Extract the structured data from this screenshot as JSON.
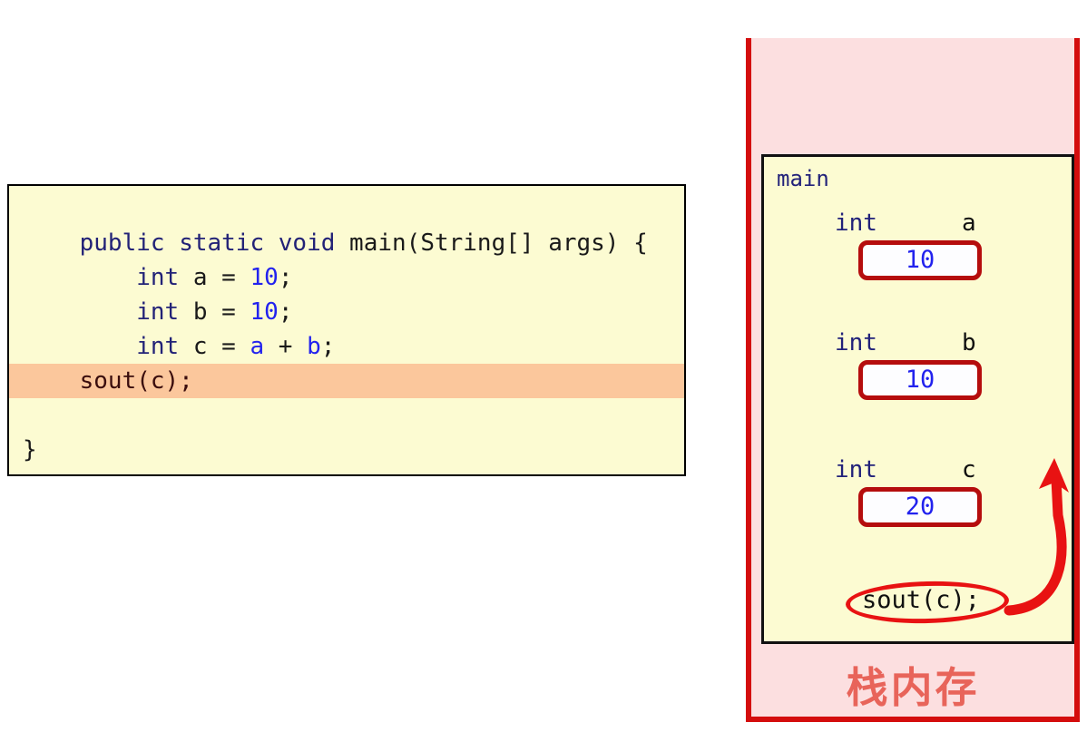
{
  "code_block": {
    "lines": [
      {
        "id": "line-signature",
        "highlighted": false,
        "tokens": [
          {
            "text": "public static void ",
            "style": "kw"
          },
          {
            "text": "main(String[] args) {",
            "style": "plain"
          }
        ],
        "plain_text": "public static void main(String[] args) {"
      },
      {
        "id": "line-declare-a",
        "highlighted": false,
        "tokens": [
          {
            "text": "    ",
            "style": "plain"
          },
          {
            "text": "int",
            "style": "kw"
          },
          {
            "text": " a = ",
            "style": "plain"
          },
          {
            "text": "10",
            "style": "lit"
          },
          {
            "text": ";",
            "style": "plain"
          }
        ],
        "plain_text": "    int a = 10;"
      },
      {
        "id": "line-declare-b",
        "highlighted": false,
        "tokens": [
          {
            "text": "    ",
            "style": "plain"
          },
          {
            "text": "int",
            "style": "kw"
          },
          {
            "text": " b = ",
            "style": "plain"
          },
          {
            "text": "10",
            "style": "lit"
          },
          {
            "text": ";",
            "style": "plain"
          }
        ],
        "plain_text": "    int b = 10;"
      },
      {
        "id": "line-declare-c",
        "highlighted": false,
        "tokens": [
          {
            "text": "    ",
            "style": "plain"
          },
          {
            "text": "int",
            "style": "kw"
          },
          {
            "text": " c = ",
            "style": "plain"
          },
          {
            "text": "a",
            "style": "var"
          },
          {
            "text": " + ",
            "style": "plain"
          },
          {
            "text": "b",
            "style": "var"
          },
          {
            "text": ";",
            "style": "plain"
          }
        ],
        "plain_text": "    int c = a + b;"
      },
      {
        "id": "line-blank-1",
        "highlighted": false,
        "tokens": [],
        "plain_text": ""
      },
      {
        "id": "line-sout",
        "highlighted": true,
        "tokens": [
          {
            "text": "    sout(c);",
            "style": "plain"
          }
        ],
        "plain_text": "    sout(c);"
      },
      {
        "id": "line-blank-2",
        "highlighted": false,
        "tokens": [],
        "plain_text": ""
      },
      {
        "id": "line-close-brace",
        "highlighted": false,
        "tokens": [
          {
            "text": "}",
            "style": "plain"
          }
        ],
        "plain_text": "}"
      }
    ]
  },
  "stack_panel": {
    "frame_label": "main",
    "footer_label": "栈内存",
    "variables": [
      {
        "type": "int",
        "name": "a",
        "value": "10"
      },
      {
        "type": "int",
        "name": "b",
        "value": "10"
      },
      {
        "type": "int",
        "name": "c",
        "value": "20"
      }
    ],
    "call_statement": "sout(c);"
  },
  "colors": {
    "page_background": "#ffffff",
    "code_background": "#fcfbd2",
    "code_border": "#000000",
    "highlight_row": "#fbc79c",
    "keyword": "#222277",
    "literal": "#2222ee",
    "plain_text": "#1a1a1a",
    "panel_background": "#fcdfe0",
    "panel_border": "#d40d0d",
    "frame_background": "#fcfbd2",
    "frame_border": "#111111",
    "value_box_border": "#b50d0d",
    "value_box_fill": "#fdfdff",
    "annotation_red": "#e81212",
    "footer_label_color": "#e8645a"
  }
}
